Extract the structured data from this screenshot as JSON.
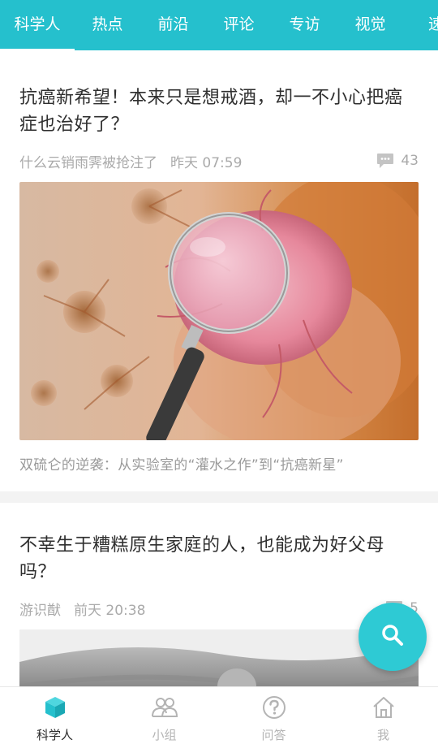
{
  "tabs": [
    "科学人",
    "热点",
    "前沿",
    "评论",
    "专访",
    "视觉",
    "速"
  ],
  "articles": [
    {
      "title": "抗癌新希望！本来只是想戒酒，却一不小心把癌症也治好了？",
      "author": "什么云销雨霁被抢注了",
      "time": "昨天 07:59",
      "comments": "43",
      "caption": "双硫仑的逆袭：从实验室的“灌水之作”到“抗癌新星”"
    },
    {
      "title": "不幸生于糟糕原生家庭的人，也能成为好父母吗？",
      "author": "游识猷",
      "time": "前天 20:38",
      "comments": "5"
    }
  ],
  "bottom_nav": [
    {
      "label": "科学人",
      "icon": "cube-icon",
      "active": true
    },
    {
      "label": "小组",
      "icon": "group-icon",
      "active": false
    },
    {
      "label": "问答",
      "icon": "question-icon",
      "active": false
    },
    {
      "label": "我",
      "icon": "home-icon",
      "active": false
    }
  ],
  "colors": {
    "accent": "#25c0cd",
    "fab": "#2ecad4"
  }
}
